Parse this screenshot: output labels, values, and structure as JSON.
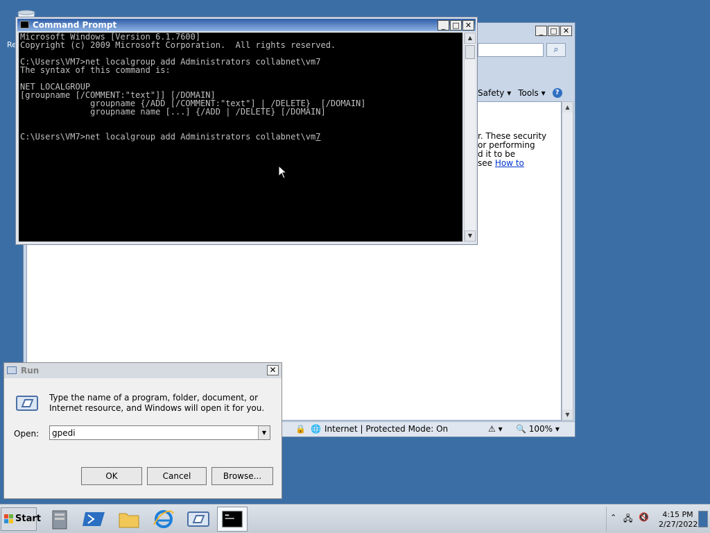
{
  "desktop": {
    "recycle_label": "Re"
  },
  "ie": {
    "paragraph": {
      "line1": "r. These security",
      "line2": "or performing",
      "line3": "d it to be",
      "line4_prefix": "see",
      "link": "How to"
    },
    "toolbar": {
      "safety_label": "Safety",
      "tools_label": "Tools"
    },
    "statusbar": {
      "zone": "Internet | Protected Mode: On",
      "zoom": "100%"
    }
  },
  "cmd": {
    "title": "Command Prompt",
    "lines": [
      "Microsoft Windows [Version 6.1.7600]",
      "Copyright (c) 2009 Microsoft Corporation.  All rights reserved.",
      "",
      "C:\\Users\\VM7>net localgroup add Administrators collabnet\\vm7",
      "The syntax of this command is:",
      "",
      "NET LOCALGROUP",
      "[groupname [/COMMENT:\"text\"]] [/DOMAIN]",
      "              groupname {/ADD [/COMMENT:\"text\"] | /DELETE}  [/DOMAIN]",
      "              groupname name [...] {/ADD | /DELETE} [/DOMAIN]",
      "",
      ""
    ],
    "current_prompt": "C:\\Users\\VM7>net localgroup add Administrators collabnet\\vm",
    "current_cursor_char": "7"
  },
  "run": {
    "title": "Run",
    "description": "Type the name of a program, folder, document, or Internet resource, and Windows will open it for you.",
    "open_label": "Open:",
    "open_value": "gpedi",
    "ok_label": "OK",
    "cancel_label": "Cancel",
    "browse_label": "Browse..."
  },
  "taskbar": {
    "start_label": "Start",
    "clock_time": "4:15 PM",
    "clock_date": "2/27/2022"
  },
  "colors": {
    "desktop": "#3b6ea5",
    "cmd_text": "#c0c0c0",
    "link": "#0033cc"
  }
}
